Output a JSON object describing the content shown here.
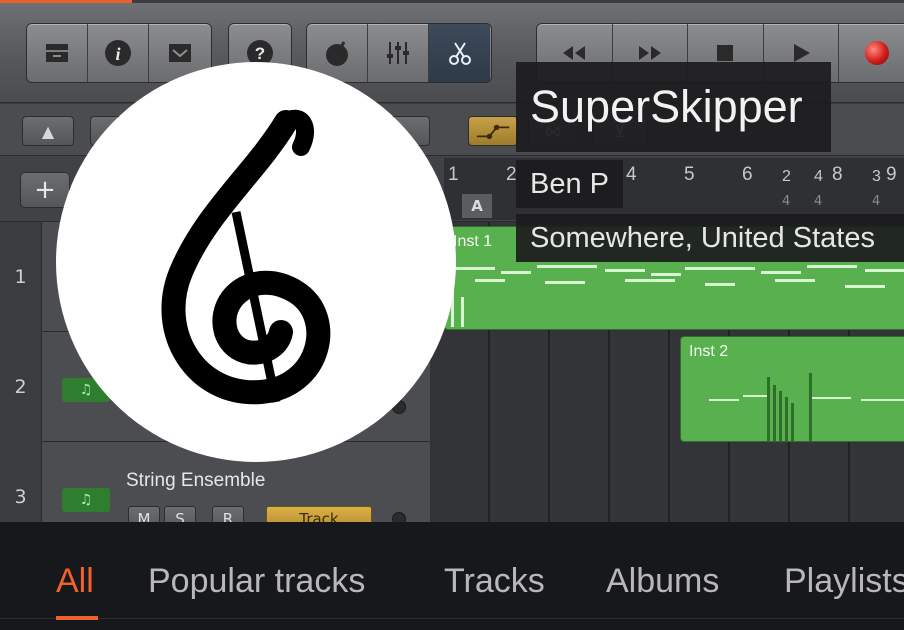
{
  "profile": {
    "name": "SuperSkipper",
    "username": "Ben P",
    "location": "Somewhere, United States"
  },
  "banner": {
    "ruler_labels": [
      "1",
      "2",
      "4",
      "5",
      "6",
      "2",
      "4",
      "8",
      "3",
      "9"
    ],
    "ruler_sub_labels": [
      "4",
      "4",
      "4",
      "4"
    ],
    "marker": "A",
    "plus": "+",
    "tracks": [
      {
        "number": "1",
        "name": "",
        "region": "Inst 1"
      },
      {
        "number": "2",
        "name": "",
        "region": "Inst 2"
      },
      {
        "number": "3",
        "name": "String Ensemble",
        "button": "Track"
      }
    ],
    "msr_buttons": [
      "M",
      "S",
      "R"
    ],
    "accent_color": "#f0612e",
    "region_color": "#58b04e"
  },
  "tabs": [
    {
      "label": "All",
      "active": true
    },
    {
      "label": "Popular tracks",
      "active": false
    },
    {
      "label": "Tracks",
      "active": false
    },
    {
      "label": "Albums",
      "active": false
    },
    {
      "label": "Playlists",
      "active": false
    }
  ]
}
